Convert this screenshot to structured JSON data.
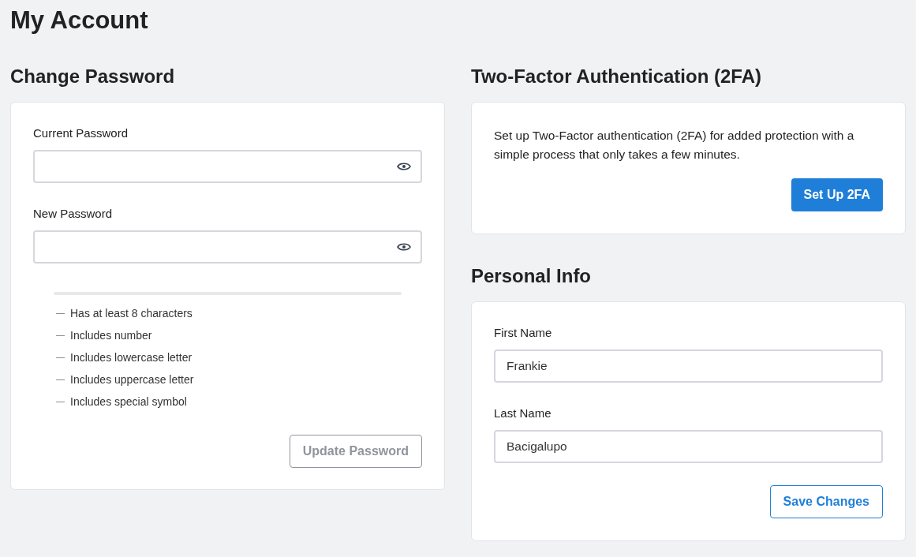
{
  "page_title": "My Account",
  "change_password": {
    "heading": "Change Password",
    "fields": [
      {
        "label": "Current Password"
      },
      {
        "label": "New Password"
      }
    ],
    "strength_meter": {
      "level": 0
    },
    "requirements": [
      {
        "text": "Has at least 8 characters",
        "met": false
      },
      {
        "text": "Includes number",
        "met": false
      },
      {
        "text": "Includes lowercase letter",
        "met": false
      },
      {
        "text": "Includes uppercase letter",
        "met": false
      },
      {
        "text": "Includes special symbol",
        "met": false
      }
    ],
    "button": {
      "label": "Update Password",
      "disabled": true
    }
  },
  "two_factor": {
    "heading": "Two-Factor Authentication (2FA)",
    "description": "Set up Two-Factor authentication (2FA) for added protection with a simple process that only takes a few minutes.",
    "button": {
      "label": "Set Up 2FA"
    }
  },
  "personal_info": {
    "heading": "Personal Info",
    "fields": [
      {
        "label": "First Name",
        "value": "Frankie"
      },
      {
        "label": "Last Name",
        "value": "Bacigalupo"
      }
    ],
    "button": {
      "label": "Save Changes"
    }
  }
}
